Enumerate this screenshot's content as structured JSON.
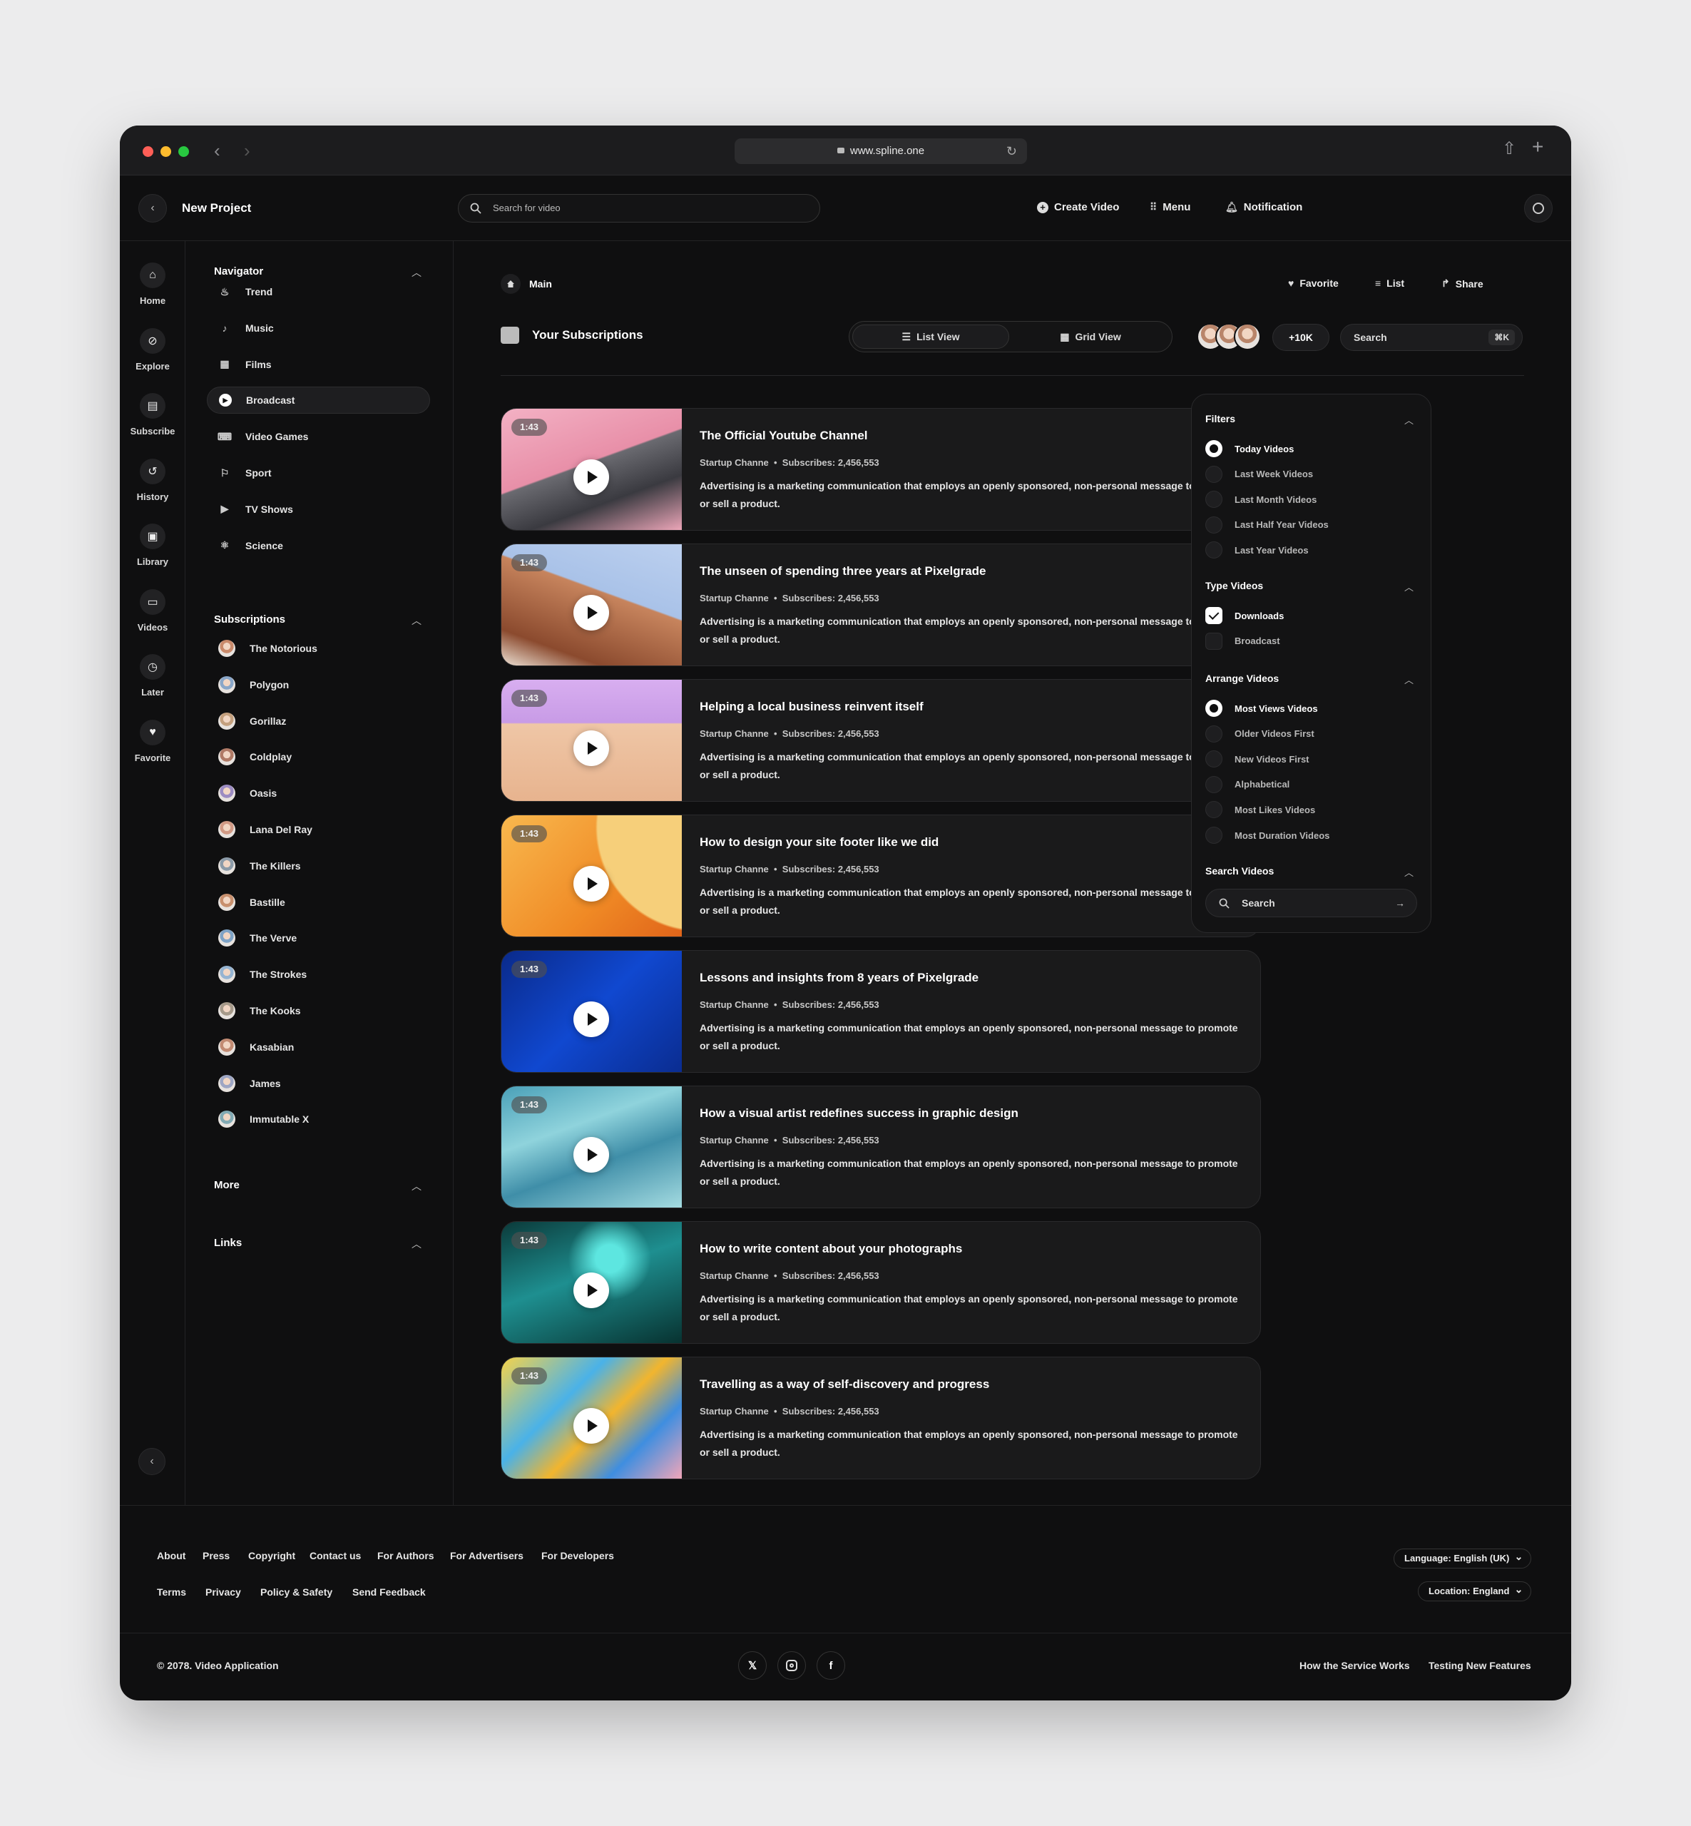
{
  "browser": {
    "url": "www.spline.one"
  },
  "header": {
    "title": "New Project",
    "search_placeholder": "Search for video",
    "create": "Create Video",
    "menu": "Menu",
    "notification": "Notification"
  },
  "rail": [
    {
      "label": "Home",
      "icon": "home-icon"
    },
    {
      "label": "Explore",
      "icon": "compass-icon"
    },
    {
      "label": "Subscribe",
      "icon": "subscribe-icon"
    },
    {
      "label": "History",
      "icon": "history-icon"
    },
    {
      "label": "Library",
      "icon": "library-icon"
    },
    {
      "label": "Videos",
      "icon": "videos-icon"
    },
    {
      "label": "Later",
      "icon": "clock-icon"
    },
    {
      "label": "Favorite",
      "icon": "heart-icon"
    }
  ],
  "sidebar": {
    "navigator_title": "Navigator",
    "nav": [
      {
        "label": "Trend",
        "icon": "flame-icon"
      },
      {
        "label": "Music",
        "icon": "music-note-icon"
      },
      {
        "label": "Films",
        "icon": "film-icon"
      },
      {
        "label": "Broadcast",
        "icon": "play-circle-icon",
        "active": true
      },
      {
        "label": "Video Games",
        "icon": "gamepad-icon"
      },
      {
        "label": "Sport",
        "icon": "running-icon"
      },
      {
        "label": "TV Shows",
        "icon": "tv-show-icon"
      },
      {
        "label": "Science",
        "icon": "atom-icon"
      }
    ],
    "subscriptions_title": "Subscriptions",
    "subscriptions": [
      "The Notorious",
      "Polygon",
      "Gorillaz",
      "Coldplay",
      "Oasis",
      "Lana Del Ray",
      "The Killers",
      "Bastille",
      "The Verve",
      "The Strokes",
      "The Kooks",
      "Kasabian",
      "James",
      "Immutable X"
    ],
    "more": "More",
    "links": "Links"
  },
  "main": {
    "breadcrumb": "Main",
    "favorite": "Favorite",
    "list": "List",
    "share": "Share",
    "title": "Your Subscriptions",
    "list_view": "List View",
    "grid_view": "Grid View",
    "count": "+10K",
    "search": "Search",
    "shortcut": "⌘K"
  },
  "videos": [
    {
      "duration": "1:43",
      "title": "The Official Youtube Channel",
      "channel": "Startup Channe",
      "subs": "Subscribes: 2,456,553",
      "desc": "Advertising is a marketing communication that employs an openly sponsored, non-personal message to promote or sell a product."
    },
    {
      "duration": "1:43",
      "title": "The unseen of spending three years at Pixelgrade",
      "channel": "Startup Channe",
      "subs": "Subscribes: 2,456,553",
      "desc": "Advertising is a marketing communication that employs an openly sponsored, non-personal message to promote or sell a product."
    },
    {
      "duration": "1:43",
      "title": "Helping a local business reinvent itself",
      "channel": "Startup Channe",
      "subs": "Subscribes: 2,456,553",
      "desc": "Advertising is a marketing communication that employs an openly sponsored, non-personal message to promote or sell a product."
    },
    {
      "duration": "1:43",
      "title": "How to design your site footer like we did",
      "channel": "Startup Channe",
      "subs": "Subscribes: 2,456,553",
      "desc": "Advertising is a marketing communication that employs an openly sponsored, non-personal message to promote or sell a product."
    },
    {
      "duration": "1:43",
      "title": "Lessons and insights from 8 years of Pixelgrade",
      "channel": "Startup Channe",
      "subs": "Subscribes: 2,456,553",
      "desc": "Advertising is a marketing communication that employs an openly sponsored, non-personal message to promote or sell a product."
    },
    {
      "duration": "1:43",
      "title": "How a visual artist redefines success in graphic design",
      "channel": "Startup Channe",
      "subs": "Subscribes: 2,456,553",
      "desc": "Advertising is a marketing communication that employs an openly sponsored, non-personal message to promote or sell a product."
    },
    {
      "duration": "1:43",
      "title": "How to write content about your photographs",
      "channel": "Startup Channe",
      "subs": "Subscribes: 2,456,553",
      "desc": "Advertising is a marketing communication that employs an openly sponsored, non-personal message to promote or sell a product."
    },
    {
      "duration": "1:43",
      "title": "Travelling as a way of self-discovery and progress",
      "channel": "Startup Channe",
      "subs": "Subscribes: 2,456,553",
      "desc": "Advertising is a marketing communication that employs an openly sponsored, non-personal message to promote or sell a product."
    }
  ],
  "filters": {
    "title": "Filters",
    "options": [
      "Today Videos",
      "Last Week Videos",
      "Last Month Videos",
      "Last Half Year Videos",
      "Last Year Videos"
    ],
    "type_title": "Type Videos",
    "types": [
      "Downloads",
      "Broadcast"
    ],
    "arrange_title": "Arrange Videos",
    "arrange": [
      "Most Views Videos",
      "Older Videos First",
      "New Videos First",
      "Alphabetical",
      "Most Likes Videos",
      "Most Duration Videos"
    ],
    "search_title": "Search Videos",
    "search_placeholder": "Search"
  },
  "footer": {
    "links1": [
      "About",
      "Press",
      "Copyright",
      "Contact us",
      "For Authors",
      "For Advertisers",
      "For Developers"
    ],
    "links2": [
      "Terms",
      "Privacy",
      "Policy & Safety",
      "Send Feedback"
    ],
    "language": "Language: English (UK)",
    "location": "Location: England",
    "copyright": "© 2078. Video Application",
    "right1": "How the Service Works",
    "right2": "Testing New Features"
  }
}
